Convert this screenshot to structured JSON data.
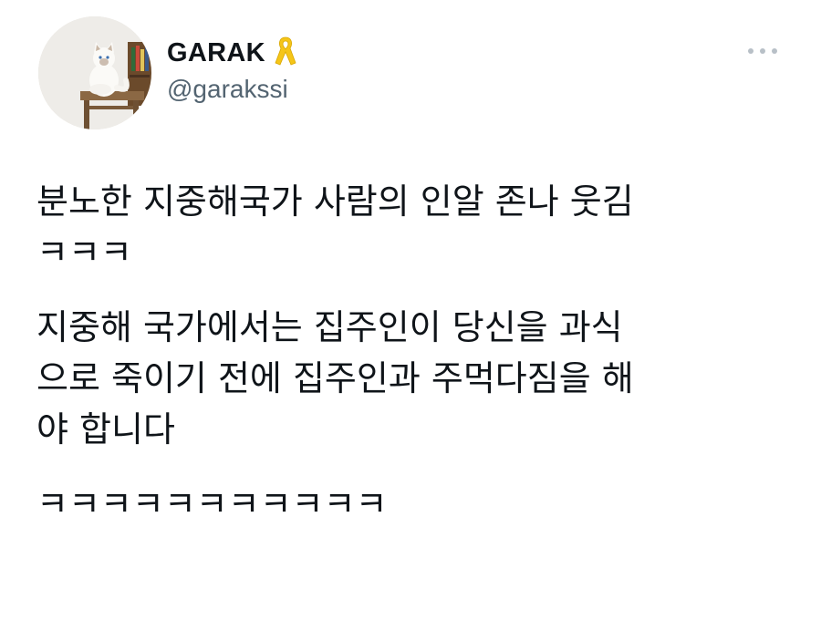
{
  "author": {
    "display_name": "GARAK",
    "handle": "@garakssi",
    "badge_icon": "yellow-ribbon-icon",
    "badge_color": "#f5c518",
    "avatar_desc": "avatar"
  },
  "menu": {
    "icon": "more-horizontal-icon"
  },
  "tweet": {
    "paragraphs": [
      "분노한 지중해국가 사람의 인알 존나 웃김\nㅋㅋㅋ",
      "지중해 국가에서는 집주인이 당신을 과식\n으로 죽이기 전에 집주인과 주먹다짐을 해\n야 합니다",
      "ㅋㅋㅋㅋㅋㅋㅋㅋㅋㅋㅋ"
    ]
  }
}
